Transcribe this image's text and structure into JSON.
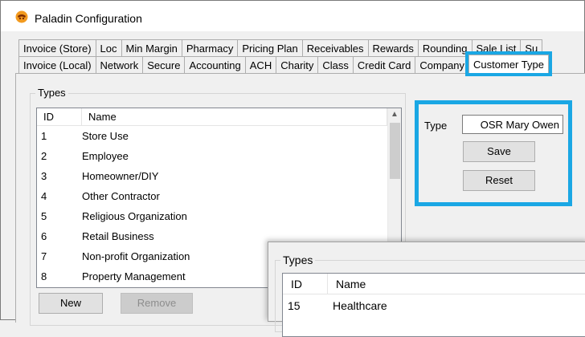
{
  "window": {
    "title": "Paladin Configuration",
    "icon": "paladin-logo-icon"
  },
  "tabs": {
    "row1": [
      "Invoice (Store)",
      "Loc",
      "Min Margin",
      "Pharmacy",
      "Pricing Plan",
      "Receivables",
      "Rewards",
      "Rounding",
      "Sale List",
      "Su"
    ],
    "row2": [
      "Invoice (Local)",
      "Network",
      "Secure",
      "Accounting",
      "ACH",
      "Charity",
      "Class",
      "Credit Card",
      "Company",
      "Customer Type"
    ],
    "active": "Customer Type"
  },
  "types_group": {
    "legend": "Types",
    "columns": [
      "ID",
      "Name"
    ],
    "rows": [
      {
        "id": "1",
        "name": "Store Use"
      },
      {
        "id": "2",
        "name": "Employee"
      },
      {
        "id": "3",
        "name": "Homeowner/DIY"
      },
      {
        "id": "4",
        "name": "Other Contractor"
      },
      {
        "id": "5",
        "name": "Religious Organization"
      },
      {
        "id": "6",
        "name": "Retail Business"
      },
      {
        "id": "7",
        "name": "Non-profit Organization"
      },
      {
        "id": "8",
        "name": "Property Management"
      }
    ],
    "new_label": "New",
    "remove_label": "Remove"
  },
  "editor": {
    "type_label": "Type",
    "type_value": "OSR Mary Owen",
    "save_label": "Save",
    "reset_label": "Reset"
  },
  "overlay": {
    "legend": "Types",
    "columns": [
      "ID",
      "Name"
    ],
    "rows": [
      {
        "id": "15",
        "name": "Healthcare"
      }
    ]
  },
  "colors": {
    "highlight": "#1aa7e4",
    "window_bg": "#f0f0f0"
  }
}
